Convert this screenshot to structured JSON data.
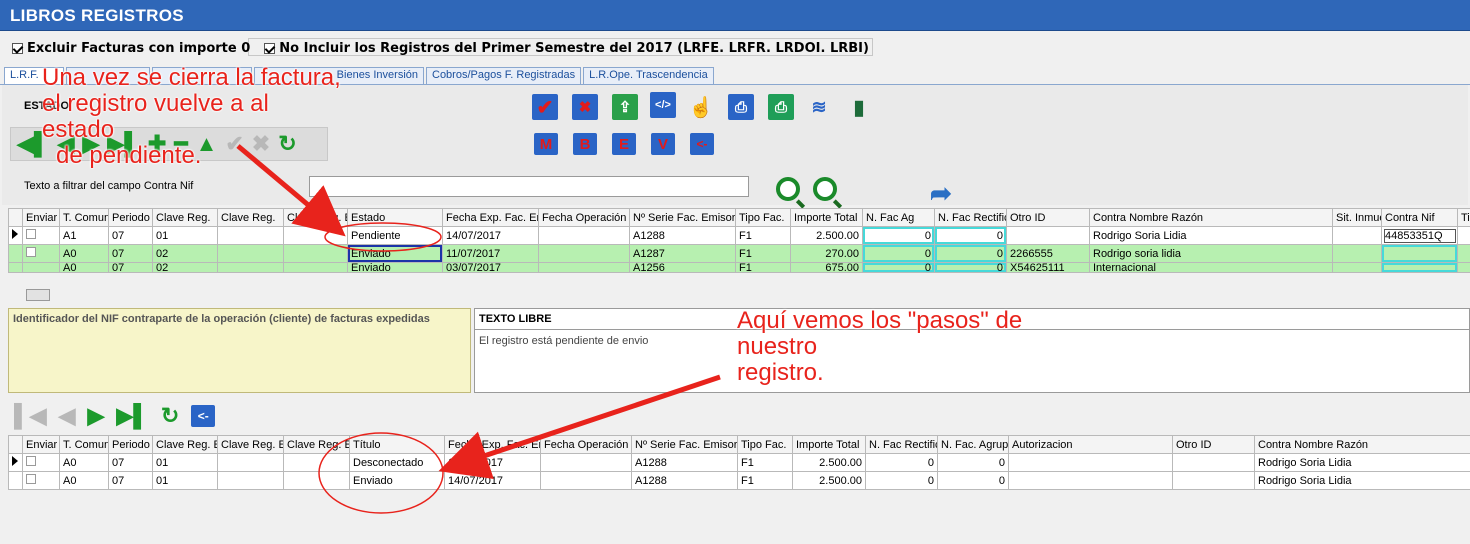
{
  "window": {
    "title": "LIBROS REGISTROS"
  },
  "options": {
    "excluir": "Excluir Facturas con importe 0",
    "noincluir": "No Incluir los Registros del Primer Semestre del 2017 (LRFE. LRFR. LRDOI. LRBI)"
  },
  "tabs": [
    "L.R.F.",
    "Bienes Inversión",
    "Cobros/Pagos F. Registradas",
    "L.R.Ope. Trascendencia"
  ],
  "estado_label": "ESTADO",
  "filter": {
    "label": "Texto a filtrar del campo Contra Nif",
    "value": ""
  },
  "icons": {
    "row1": [
      "check-icon",
      "cancel-icon",
      "send-icon",
      "xml-icon",
      "hand-icon",
      "print-icon",
      "print-green-icon",
      "signal-icon",
      "exit-icon"
    ],
    "row2": [
      "M",
      "B",
      "E",
      "V",
      "<-"
    ]
  },
  "grid1": {
    "columns": [
      "Enviar",
      "T. Comun",
      "Periodo",
      "Clave Reg.",
      "Clave Reg.",
      "Clave Reg. E",
      "Estado",
      "Fecha Exp. Fac. Em",
      "Fecha Operación",
      "Nº Serie Fac. Emisor",
      "Tipo Fac.",
      "Importe Total",
      "N. Fac Ag",
      "N. Fac Rectific",
      "Otro ID",
      "Contra Nombre Razón",
      "Sit. Inmue",
      "Contra Nif",
      "Ti"
    ],
    "rows": [
      [
        "",
        "A1",
        "07",
        "01",
        "",
        "",
        "Pendiente",
        "14/07/2017",
        "",
        "A1288",
        "F1",
        "2.500.00",
        "0",
        "0",
        "",
        "Rodrigo  Soria Lidia",
        "",
        "44853351Q",
        ""
      ],
      [
        "",
        "A0",
        "07",
        "02",
        "",
        "",
        "Enviado",
        "11/07/2017",
        "",
        "A1287",
        "F1",
        "270.00",
        "0",
        "0",
        "2266555",
        "Rodrigo  soria lidia",
        "",
        "",
        ""
      ],
      [
        "",
        "A0",
        "07",
        "02",
        "",
        "",
        "Enviado",
        "03/07/2017",
        "",
        "A1256",
        "F1",
        "675.00",
        "0",
        "0",
        "X54625111",
        "Internacional",
        "",
        "",
        ""
      ]
    ]
  },
  "description": {
    "left": "Identificador del NIF contraparte de la operación (cliente) de facturas expedidas",
    "right_title": "TEXTO LIBRE",
    "right_text": "El registro está pendiente de envio"
  },
  "grid2": {
    "columns": [
      "Enviar",
      "T. Comun",
      "Periodo",
      "Clave Reg. E",
      "Clave Reg. E",
      "Clave Reg. E",
      "Título",
      "Fecha Exp. Fac. Em",
      "Fecha Operación",
      "Nº Serie Fac. Emisor",
      "Tipo Fac.",
      "Importe Total",
      "N. Fac Rectific",
      "N. Fac. Agrupa",
      "Autorizacion",
      "Otro ID",
      "Contra Nombre Razón"
    ],
    "rows": [
      [
        "",
        "A0",
        "07",
        "01",
        "",
        "",
        "Desconectado",
        "14/07/2017",
        "",
        "A1288",
        "F1",
        "2.500.00",
        "0",
        "0",
        "",
        "",
        "Rodrigo  Soria Lidia"
      ],
      [
        "",
        "A0",
        "07",
        "01",
        "",
        "",
        "Enviado",
        "14/07/2017",
        "",
        "A1288",
        "F1",
        "2.500.00",
        "0",
        "0",
        "",
        "",
        "Rodrigo  Soria Lidia"
      ]
    ]
  },
  "annotations": {
    "a1": [
      "Una vez se cierra la factura,",
      "el registro vuelve a al",
      "estado",
      "de pendiente."
    ],
    "a2": [
      "Aquí vemos los \"pasos\" de",
      "nuestro",
      "registro."
    ]
  }
}
